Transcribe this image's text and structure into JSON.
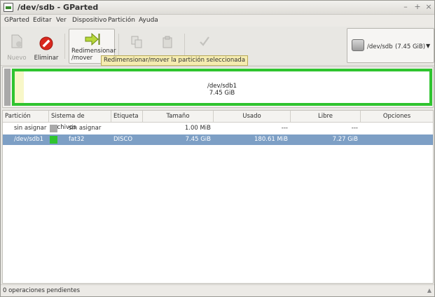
{
  "window": {
    "title": "/dev/sdb - GParted"
  },
  "menu": [
    "GParted",
    "Editar",
    "Ver",
    "Dispositivo",
    "Partición",
    "Ayuda"
  ],
  "toolbar": {
    "new_label": "Nuevo",
    "delete_label": "Eliminar",
    "resize_label_1": "Redimensionar",
    "resize_label_2": "/mover",
    "tooltip": "Redimensionar/mover la partición seleccionada"
  },
  "device": {
    "name": "/dev/sdb",
    "size": "(7.45 GiB)"
  },
  "map": {
    "partition_name": "/dev/sdb1",
    "partition_size": "7.45 GiB"
  },
  "table": {
    "columns": [
      "Partición",
      "Sistema de archivos",
      "Etiqueta",
      "Tamaño",
      "Usado",
      "Libre",
      "Opciones"
    ],
    "rows": [
      {
        "partition": "sin asignar",
        "filesystem": "sin asignar",
        "label": "",
        "size": "1.00 MiB",
        "used": "---",
        "free": "---",
        "color": "#a9a9a9"
      },
      {
        "partition": "/dev/sdb1",
        "filesystem": "fat32",
        "label": "DISCO",
        "size": "7.45 GiB",
        "used": "180.61 MiB",
        "free": "7.27 GiB",
        "color": "#2fc42f"
      }
    ]
  },
  "status": {
    "text": "0 operaciones pendientes"
  },
  "colors": {
    "selection": "#7d9fc5",
    "fat32": "#2fc42f",
    "unallocated": "#a9a9a9",
    "tooltip_bg": "#f5ecb0"
  }
}
